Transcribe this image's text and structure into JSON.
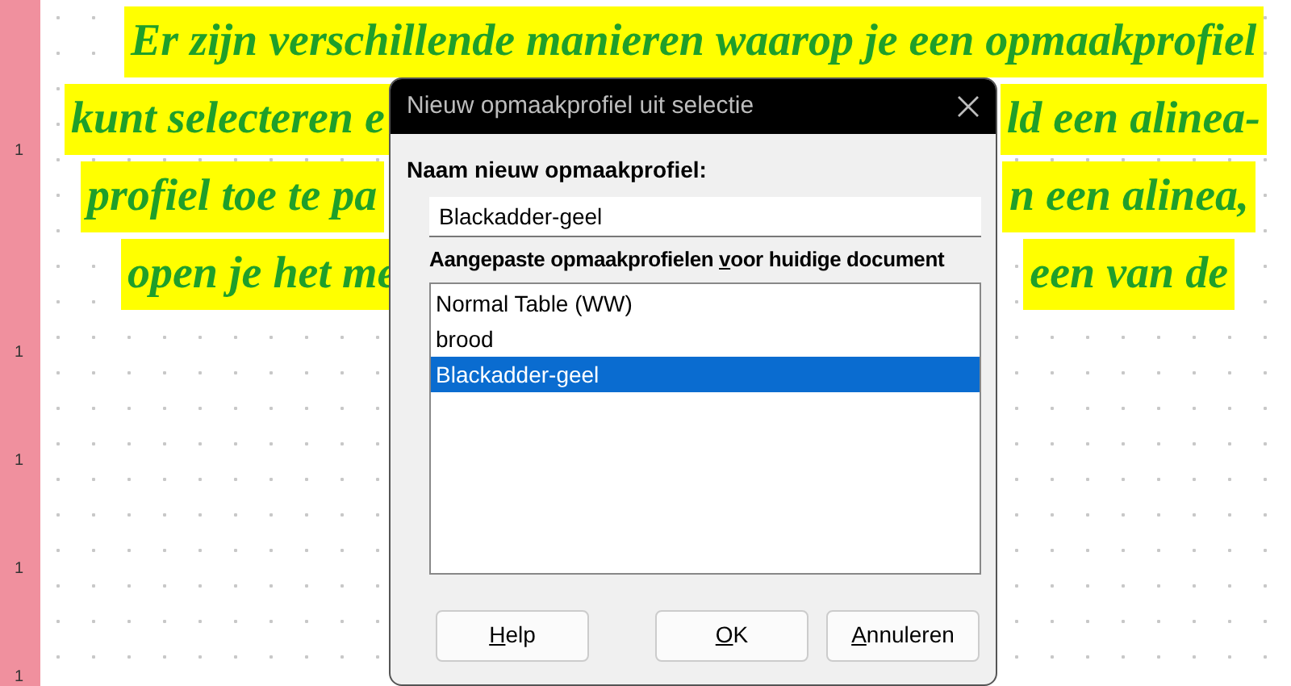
{
  "document": {
    "line_numbers": [
      "1",
      "1",
      "1",
      "1",
      "1"
    ],
    "lines": [
      {
        "left": "Er zijn verschillende manieren waarop je een opmaakprofiel"
      },
      {
        "left": "kunt selecteren e",
        "right": "ld een alinea-"
      },
      {
        "left": "profiel toe te pa",
        "right": "n een alinea,"
      },
      {
        "left": "open je het me",
        "right": "een van de"
      }
    ]
  },
  "dialog": {
    "title": "Nieuw opmaakprofiel uit selectie",
    "name_label": "Naam nieuw opmaakprofiel:",
    "name_value": "Blackadder-geel",
    "list_label": {
      "before": "Aangepaste opmaakprofielen ",
      "mnemonic": "v",
      "after": "oor huidige document"
    },
    "styles": [
      {
        "label": "Normal Table (WW)",
        "selected": false
      },
      {
        "label": "brood",
        "selected": false
      },
      {
        "label": "Blackadder-geel",
        "selected": true
      }
    ],
    "buttons": [
      {
        "mnemonic": "H",
        "after": "elp"
      },
      {
        "mnemonic": "O",
        "after": "K"
      },
      {
        "mnemonic": "A",
        "after": "nnuleren"
      }
    ]
  }
}
